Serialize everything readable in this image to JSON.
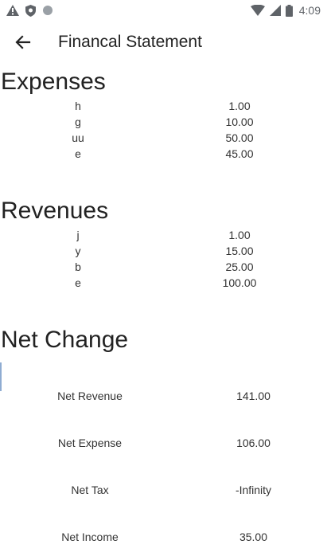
{
  "status_bar": {
    "time": "4:09",
    "left_icons": [
      "warning-icon",
      "shield-icon",
      "dot-icon"
    ],
    "right_icons": [
      "wifi-icon",
      "signal-icon",
      "battery-icon"
    ]
  },
  "app_bar": {
    "title": "Financal Statement",
    "back_icon": "arrow-left-icon"
  },
  "expenses": {
    "heading": "Expenses",
    "items": [
      {
        "name": "h",
        "amount": "1.00"
      },
      {
        "name": "g",
        "amount": "10.00"
      },
      {
        "name": "uu",
        "amount": "50.00"
      },
      {
        "name": "e",
        "amount": "45.00"
      }
    ]
  },
  "revenues": {
    "heading": "Revenues",
    "items": [
      {
        "name": "j",
        "amount": "1.00"
      },
      {
        "name": "y",
        "amount": "15.00"
      },
      {
        "name": "b",
        "amount": "25.00"
      },
      {
        "name": "e",
        "amount": "100.00"
      }
    ]
  },
  "net_change": {
    "heading": "Net Change",
    "rows": [
      {
        "label": "Net Revenue",
        "value": "141.00"
      },
      {
        "label": "Net Expense",
        "value": "106.00"
      },
      {
        "label": "Net Tax",
        "value": "-Infinity"
      },
      {
        "label": "Net Income",
        "value": "35.00"
      }
    ]
  }
}
